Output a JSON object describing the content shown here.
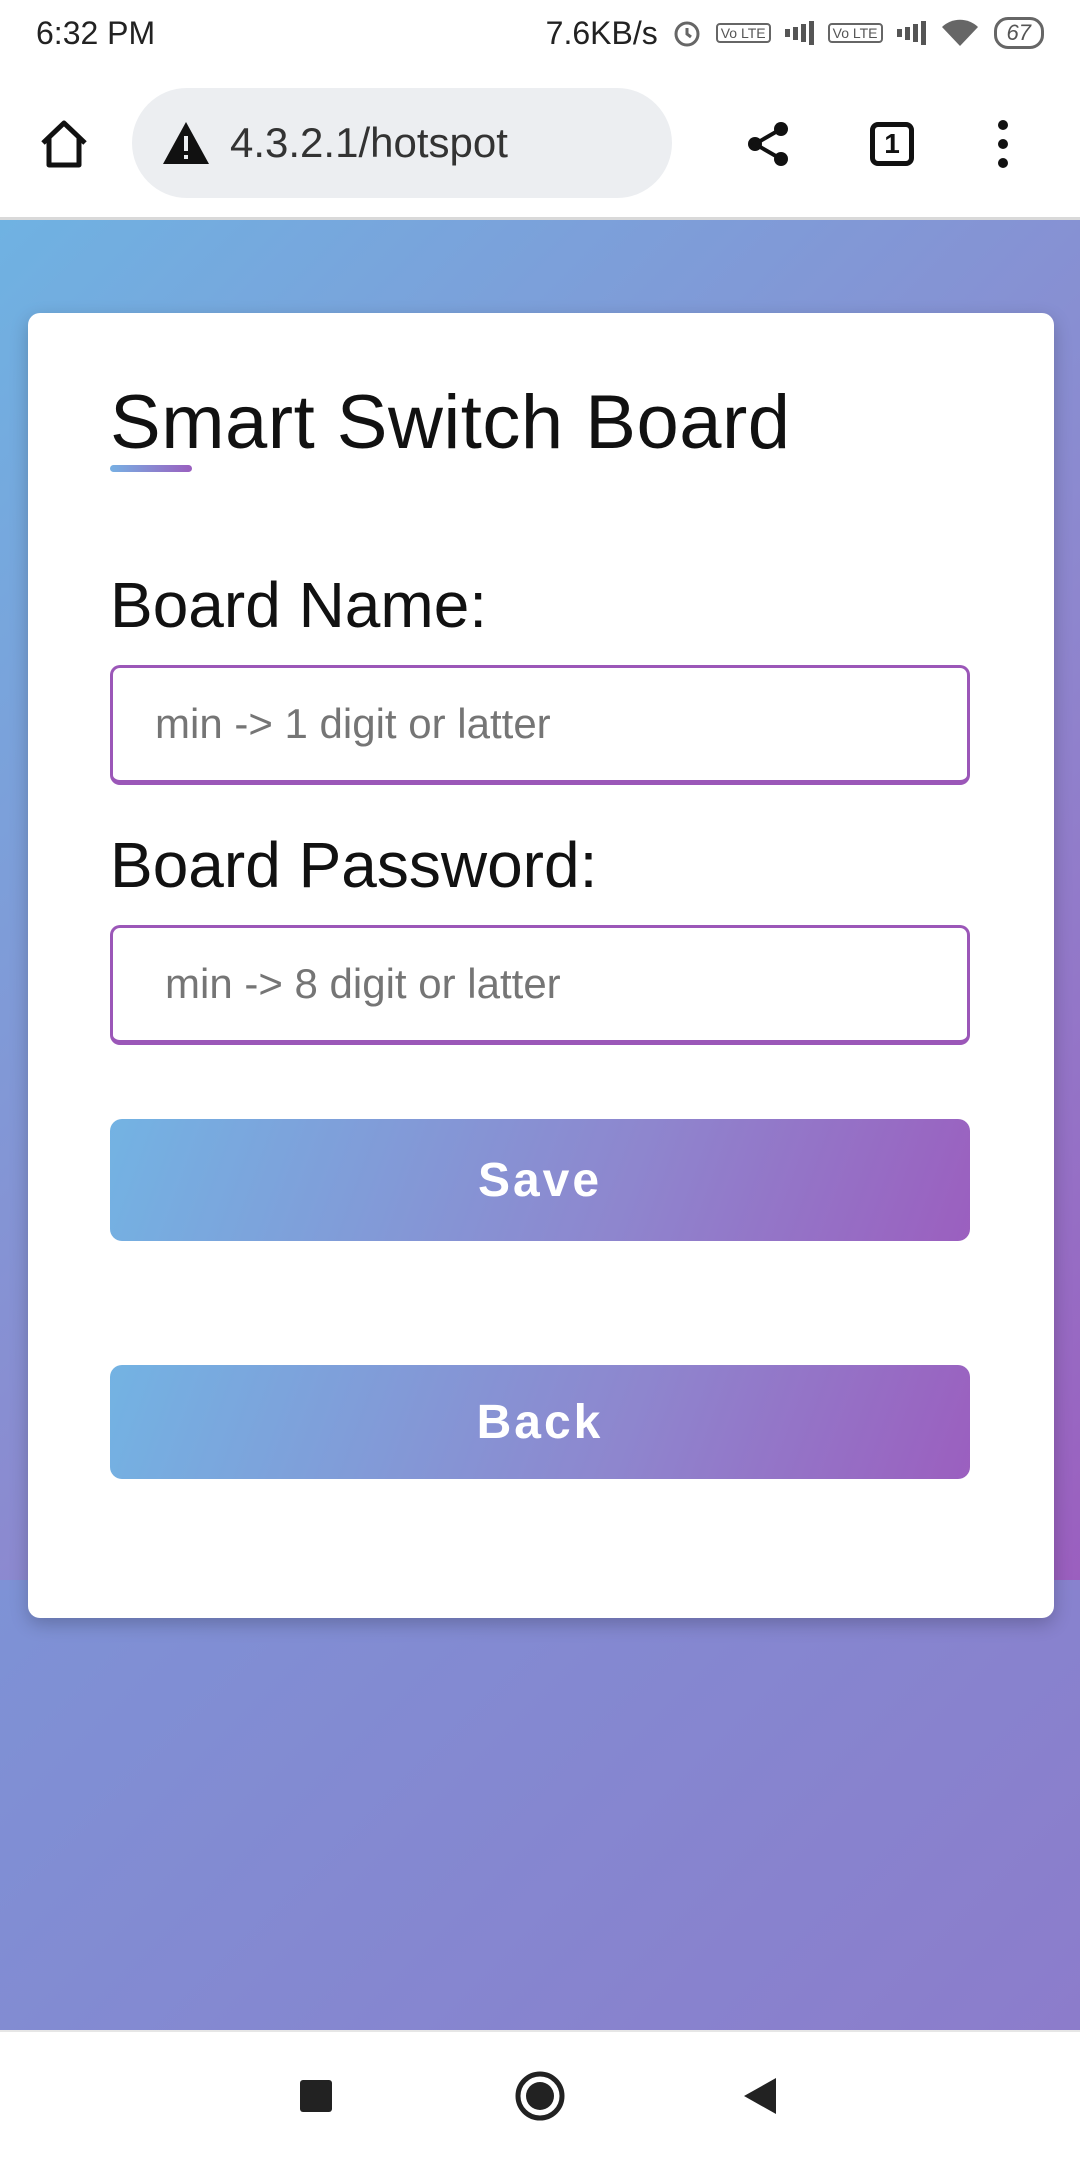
{
  "status_bar": {
    "time": "6:32 PM",
    "net_speed": "7.6KB/s",
    "volte_label": "Vo LTE",
    "battery": "67",
    "icons": [
      "alarm-icon",
      "signal-icon",
      "wifi-icon",
      "battery-icon"
    ]
  },
  "browser": {
    "url": "4.3.2.1/hotspot",
    "tab_count": "1",
    "icons": [
      "home-icon",
      "warning-icon",
      "share-icon",
      "tabs-icon",
      "more-icon"
    ]
  },
  "form": {
    "title": "Smart Switch Board",
    "board_name_label": "Board Name:",
    "board_name_placeholder": "min -> 1 digit or latter",
    "board_name_value": "",
    "board_password_label": "Board Password:",
    "board_password_placeholder": "min -> 8 digit or latter",
    "board_password_value": "",
    "save_label": "Save",
    "back_label": "Back"
  },
  "colors": {
    "gradient_start": "#73b3e3",
    "gradient_end": "#9b5fbf",
    "input_border": "#9b57b8"
  },
  "nav_bar": {
    "icons": [
      "recent-apps-icon",
      "home-circle-icon",
      "back-triangle-icon"
    ]
  }
}
